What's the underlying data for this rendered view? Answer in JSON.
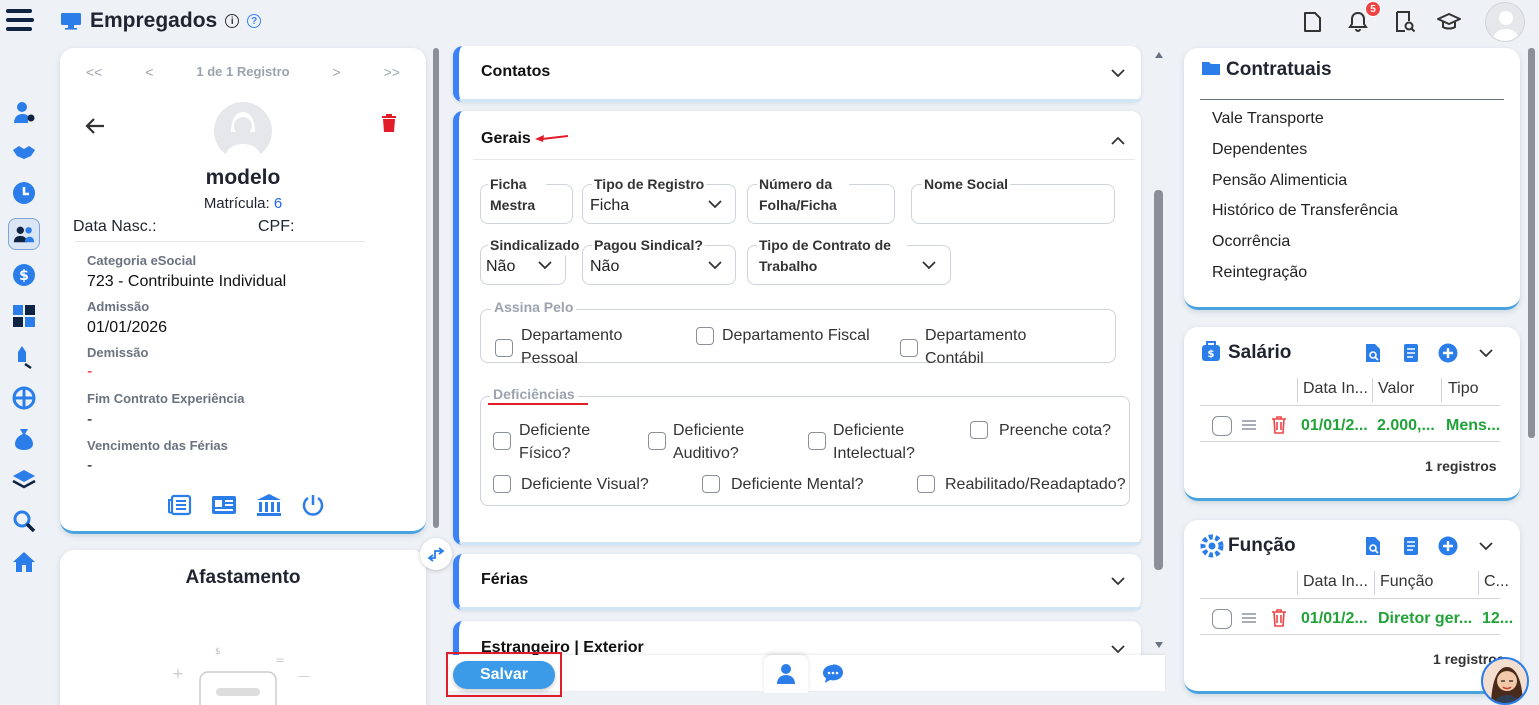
{
  "header": {
    "title": "Empregados",
    "notification_count": "5"
  },
  "pager": {
    "label": "1 de 1 Registro"
  },
  "profile": {
    "name": "modelo",
    "matricula_label": "Matrícula:",
    "matricula_value": "6",
    "data_nasc_label": "Data Nasc.:",
    "cpf_label": "CPF:",
    "fields": [
      {
        "label": "Categoria eSocial",
        "value": "723 - Contribuinte Individual"
      },
      {
        "label": "Admissão",
        "value": "01/01/2026"
      },
      {
        "label": "Demissão",
        "value": "-"
      },
      {
        "label": "Fim Contrato Experiência",
        "value": "-"
      },
      {
        "label": "Vencimento das Férias",
        "value": "-"
      }
    ]
  },
  "afastamento": {
    "title": "Afastamento"
  },
  "sections": {
    "contatos": "Contatos",
    "gerais": "Gerais",
    "ferias": "Férias",
    "estrangeiro": "Estrangeiro | Exterior"
  },
  "gerais_form": {
    "ficha_mestra_label": "Ficha Mestra",
    "tipo_registro_label": "Tipo de Registro",
    "tipo_registro_value": "Ficha",
    "numero_folha_label": "Número da Folha/Ficha",
    "nome_social_label": "Nome Social",
    "sindicalizado_label": "Sindicalizado",
    "sindicalizado_value": "Não",
    "pagou_sindical_label": "Pagou Sindical?",
    "pagou_sindical_value": "Não",
    "tipo_contrato_label": "Tipo de Contrato de Trabalho",
    "assina_pelo_label": "Assina Pelo",
    "assina_options": [
      "Departamento Pessoal",
      "Departamento Fiscal",
      "Departamento Contábil"
    ],
    "deficiencias_label": "Deficiências",
    "deficiencias_options": [
      "Deficiente Físico?",
      "Deficiente Auditivo?",
      "Deficiente Intelectual?",
      "Preenche cota?",
      "Deficiente Visual?",
      "Deficiente Mental?",
      "Reabilitado/Readaptado?"
    ]
  },
  "contratuais": {
    "title": "Contratuais",
    "links": [
      "Vale Transporte",
      "Dependentes",
      "Pensão Alimenticia",
      "Histórico de Transferência",
      "Ocorrência",
      "Reintegração"
    ]
  },
  "salario": {
    "title": "Salário",
    "headers": [
      "Data In...",
      "Valor",
      "Tipo"
    ],
    "row": [
      "01/01/2...",
      "2.000,...",
      "Mens..."
    ],
    "count": "1 registros"
  },
  "funcao": {
    "title": "Função",
    "headers": [
      "Data In...",
      "Função",
      "C..."
    ],
    "row": [
      "01/01/2...",
      "Diretor ger...",
      "12..."
    ],
    "count": "1 registros"
  },
  "footer": {
    "save_label": "Salvar"
  },
  "colors": {
    "accent": "#3b82f6",
    "green": "#22a33a",
    "danger": "#ef4444",
    "navy": "#0f2342"
  }
}
